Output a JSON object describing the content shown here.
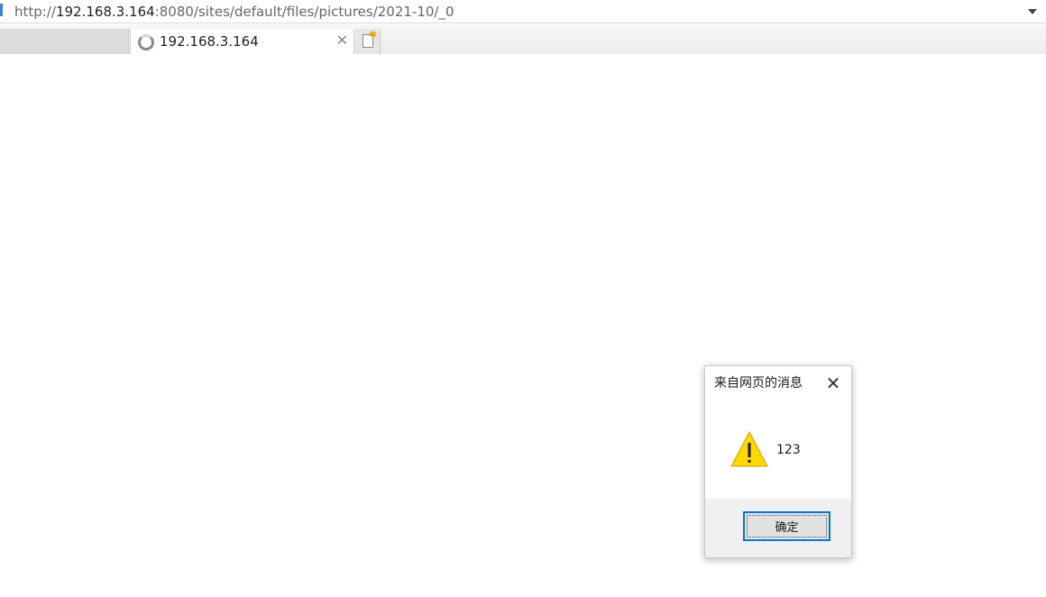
{
  "addressbar": {
    "url_scheme": "http://",
    "url_host": "192.168.3.164",
    "url_rest": ":8080/sites/default/files/pictures/2021-10/_0",
    "dropdown_icon": "chevron-down-icon"
  },
  "tabs": {
    "active": {
      "title": "192.168.3.164",
      "icon": "loading-spinner-icon",
      "close_label": "✕"
    },
    "new_tab_icon": "new-tab-icon"
  },
  "dialog": {
    "title": "来自网页的消息",
    "close_label": "✕",
    "icon": "warning-icon",
    "message": "123",
    "ok_label": "确定",
    "colors": {
      "warning_fill": "#FFD800",
      "focus_border": "#0078D7",
      "footer_bg": "#F0F0F0"
    }
  }
}
